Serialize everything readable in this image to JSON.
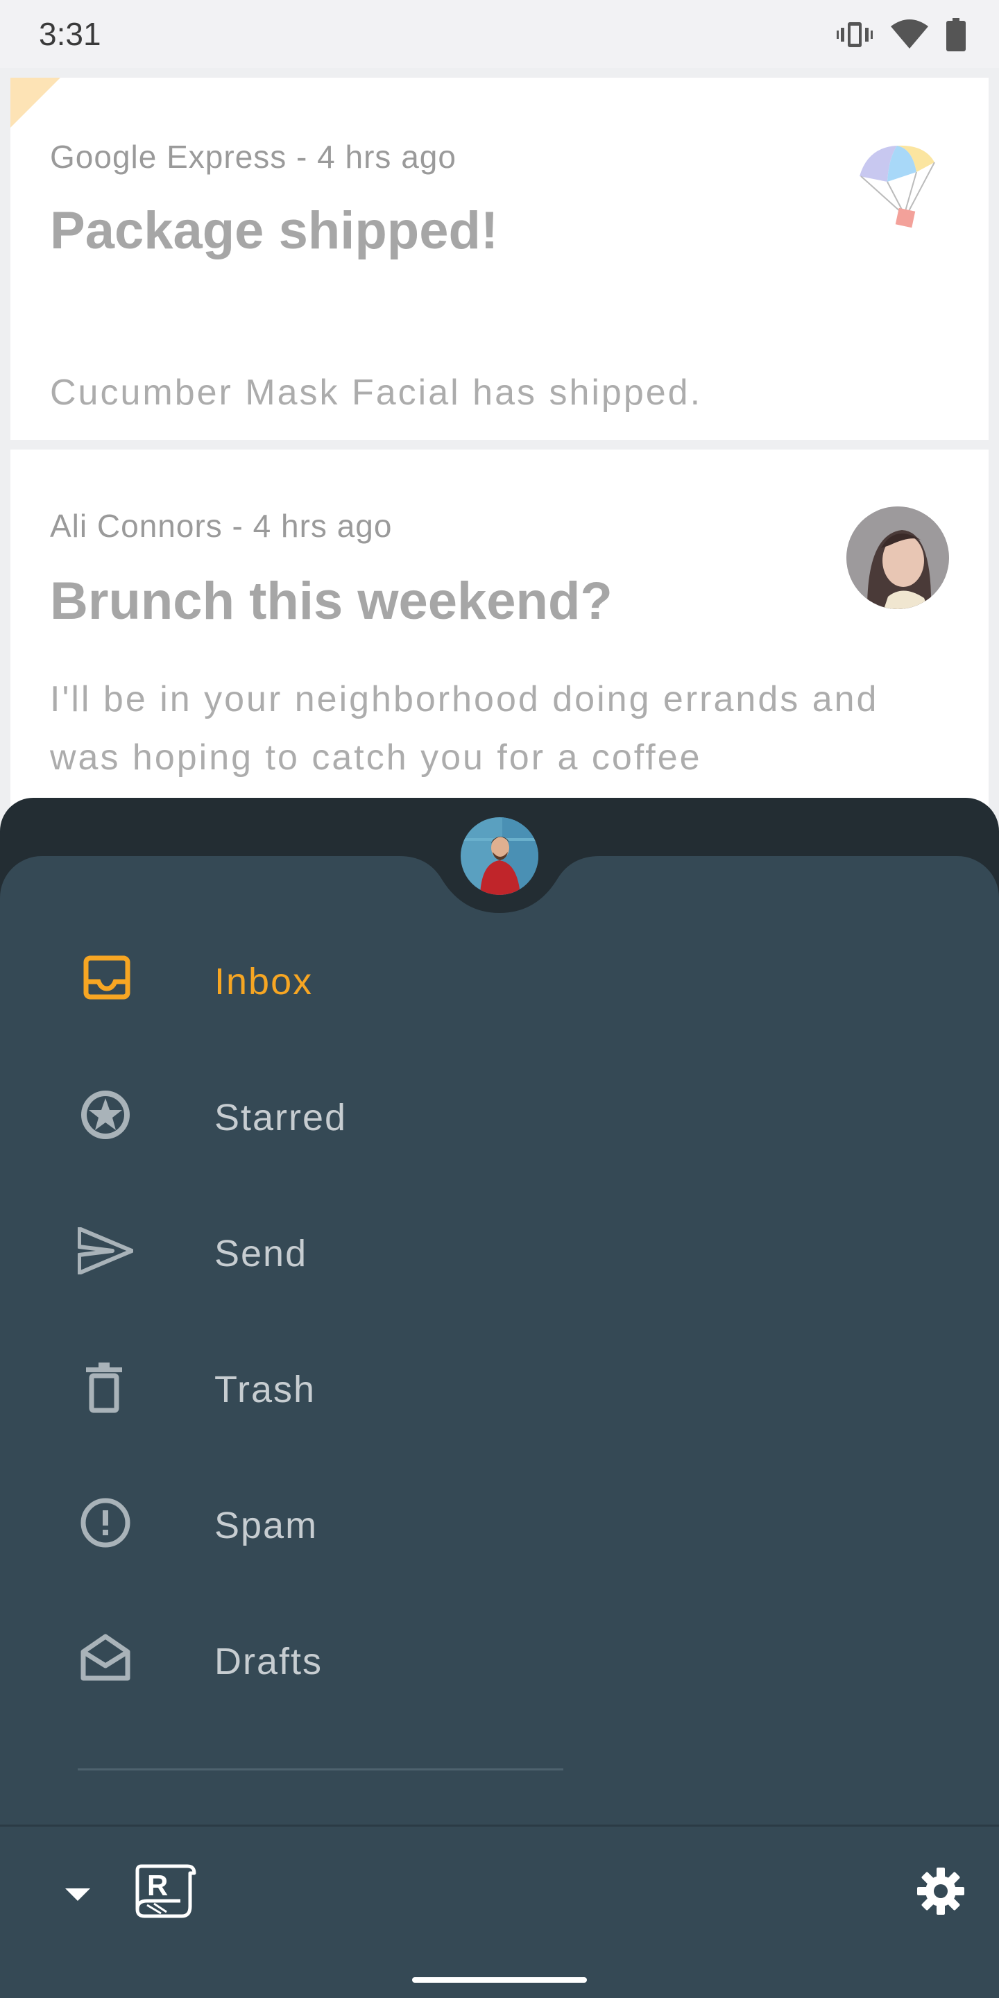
{
  "status_bar": {
    "time": "3:31",
    "icons": [
      "vibrate-icon",
      "wifi-icon",
      "battery-icon"
    ]
  },
  "messages": [
    {
      "meta": "Google Express - 4 hrs ago",
      "title": "Package shipped!",
      "body": "Cucumber Mask Facial has shipped.",
      "icon": "parachute-icon"
    },
    {
      "meta": "Ali Connors - 4 hrs ago",
      "title": "Brunch this weekend?",
      "body": "I'll be in your neighborhood doing errands and was hoping to catch you for a coffee",
      "icon": "sender-avatar"
    }
  ],
  "drawer": {
    "items": [
      {
        "label": "Inbox",
        "icon": "inbox-icon",
        "active": true
      },
      {
        "label": "Starred",
        "icon": "star-icon",
        "active": false
      },
      {
        "label": "Send",
        "icon": "send-icon",
        "active": false
      },
      {
        "label": "Trash",
        "icon": "trash-icon",
        "active": false
      },
      {
        "label": "Spam",
        "icon": "spam-icon",
        "active": false
      },
      {
        "label": "Drafts",
        "icon": "drafts-icon",
        "active": false
      }
    ]
  },
  "bottom_bar": {
    "icons": [
      "chevron-down-icon",
      "reply-logo-icon",
      "gear-icon"
    ]
  },
  "colors": {
    "accent": "#f7a623",
    "drawer_bg": "#354955",
    "drawer_dark": "#232d33",
    "nav_text": "#c7cdd1"
  }
}
